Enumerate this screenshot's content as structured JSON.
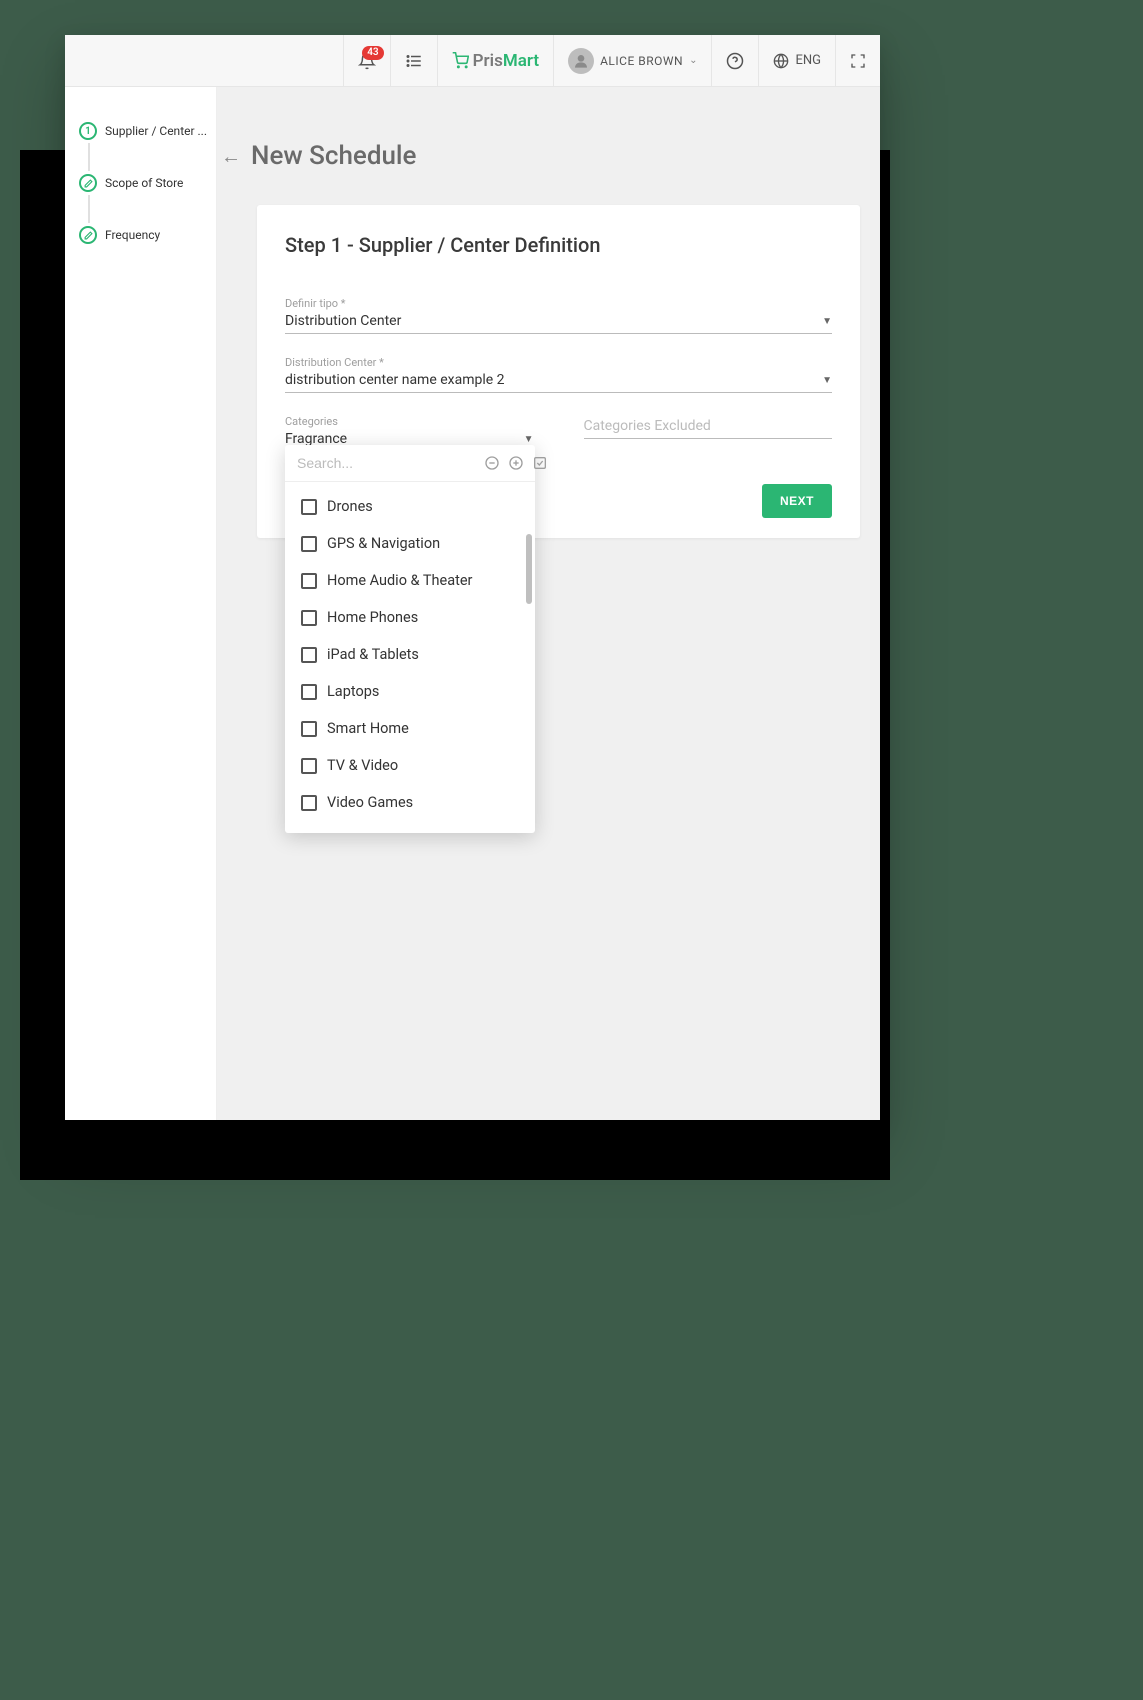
{
  "topbar": {
    "notification_count": "43",
    "brand_pris": "Pris",
    "brand_mart": "Mart",
    "user_name": "ALICE BROWN",
    "lang": "ENG"
  },
  "sidebar": {
    "steps": [
      {
        "num": "1",
        "label": "Supplier / Center ..."
      },
      {
        "num": "",
        "label": "Scope of Store"
      },
      {
        "num": "",
        "label": "Frequency"
      }
    ]
  },
  "page": {
    "title": "New Schedule"
  },
  "card": {
    "title": "Step 1 - Supplier / Center Definition",
    "field_type_label": "Definir tipo *",
    "field_type_value": "Distribution Center",
    "field_dc_label": "Distribution Center *",
    "field_dc_value": "distribution center name example 2",
    "field_cat_label": "Categories",
    "field_cat_value": "Fragrance",
    "field_catex_label": "",
    "field_catex_placeholder": "Categories Excluded",
    "next_label": "NEXT"
  },
  "dropdown": {
    "search_placeholder": "Search...",
    "items": [
      "Drones",
      "GPS & Navigation",
      "Home Audio & Theater",
      "Home Phones",
      "iPad & Tablets",
      "Laptops",
      "Smart Home",
      "TV & Video",
      "Video Games"
    ]
  }
}
